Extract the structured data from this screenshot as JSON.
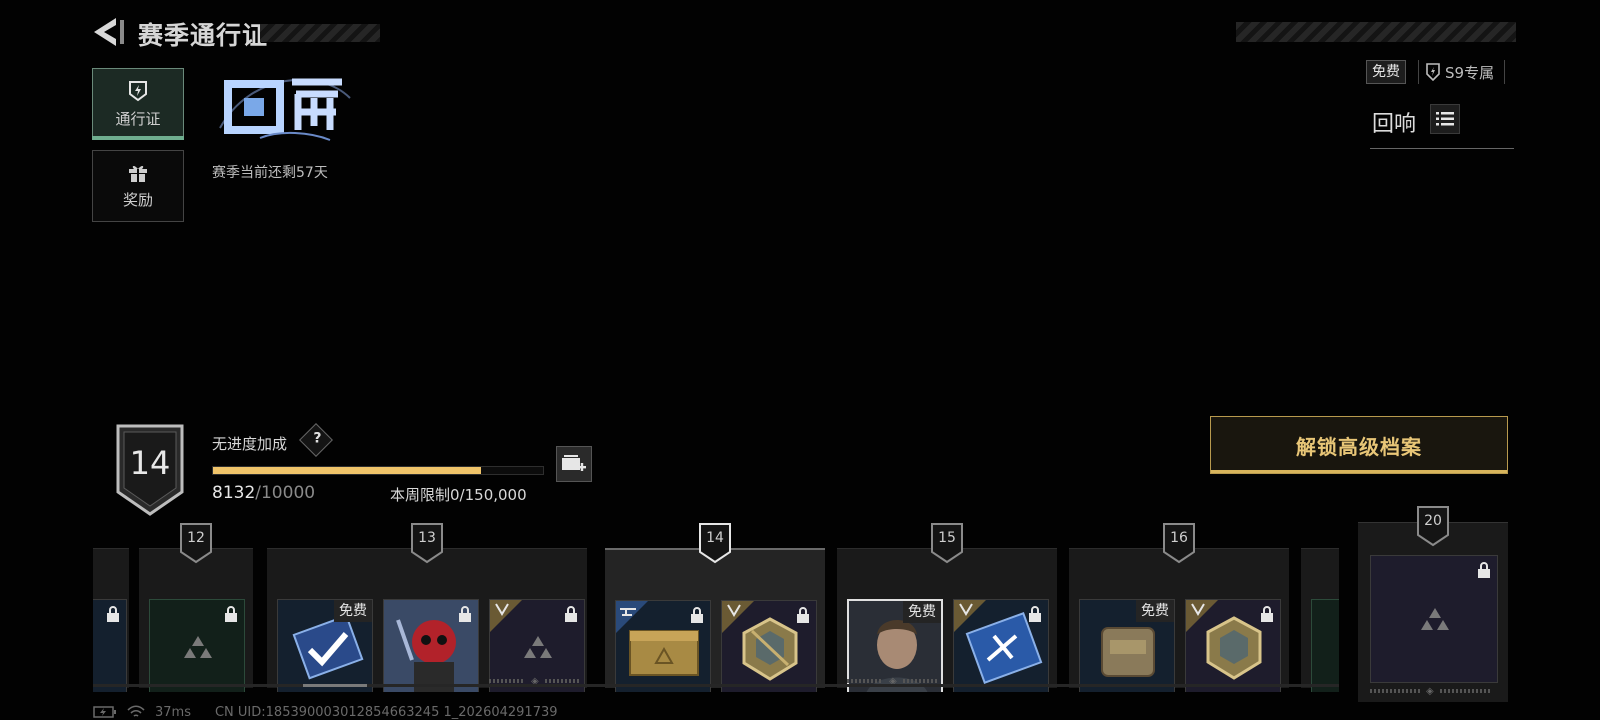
{
  "header": {
    "title": "赛季通行证"
  },
  "sidebar": {
    "tabs": [
      {
        "label": "通行证",
        "icon": "pass-icon",
        "active": true
      },
      {
        "label": "奖励",
        "icon": "gift-icon",
        "active": false
      }
    ]
  },
  "season": {
    "remaining": "赛季当前还剩57天"
  },
  "modes": {
    "free": "免费",
    "s9": "S9专属"
  },
  "echo": {
    "title": "回响"
  },
  "level": {
    "current": "14",
    "progress_fraction": 0.8132
  },
  "bonus": {
    "label": "无进度加成",
    "help": "?"
  },
  "xp": {
    "current": "8132",
    "max": "/10000"
  },
  "weekly": {
    "label": "本周限制",
    "value": "0/150,000"
  },
  "unlock": {
    "label": "解锁高级档案"
  },
  "track": {
    "levels": [
      {
        "level": "12",
        "free_tag": ""
      },
      {
        "level": "13",
        "free_tag": "免费"
      },
      {
        "level": "14",
        "free_tag": ""
      },
      {
        "level": "15",
        "free_tag": "免费"
      },
      {
        "level": "16",
        "free_tag": "免费"
      },
      {
        "level": "20",
        "free_tag": ""
      }
    ]
  },
  "status": {
    "ping": "37ms",
    "uid": "CN UID:185390003012854663245 1_202604291739"
  },
  "colors": {
    "accent_gold": "#e8c677",
    "progress_fill": "#f0c46a",
    "tab_active": "#6fae8f"
  }
}
